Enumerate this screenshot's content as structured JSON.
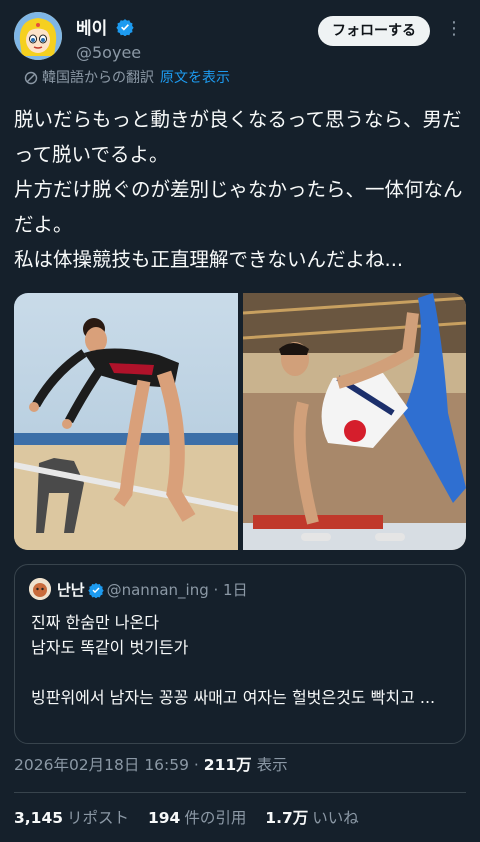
{
  "author": {
    "display_name": "베이",
    "handle": "@5oyee"
  },
  "actions": {
    "follow_label": "フォローする",
    "more_label": "⋮"
  },
  "translation": {
    "from_label": "韓国語からの翻訳",
    "show_original_label": "原文を表示"
  },
  "tweet": {
    "text": "脱いだらもっと動きが良くなるって思うなら、男だって脱いでるよ。\n片方だけ脱ぐのが差別じゃなかったら、一体何なんだよ。\n私は体操競技も正直理解できないんだよね..."
  },
  "quote": {
    "name": "난난",
    "handle": "@nannan_ing",
    "separator": " · ",
    "time": "1日",
    "text": "진짜 한숨만 나온다\n남자도 똑같이 벗기든가\n\n빙판위에서 남자는 꽁꽁 싸매고 여자는 헐벗은것도 빡치고 ..."
  },
  "meta": {
    "timestamp": "2026年02月18日 16:59 · ",
    "views_count": "211万",
    "views_label": " 表示"
  },
  "stats": {
    "reposts_count": "3,145",
    "reposts_label": "リポスト",
    "quotes_count": "194",
    "quotes_label": "件の引用",
    "likes_count": "1.7万",
    "likes_label": "いいね"
  },
  "colors": {
    "background": "#15202b",
    "accent": "#1d9bf0",
    "secondary_text": "#8b98a5",
    "border": "#38444d"
  }
}
